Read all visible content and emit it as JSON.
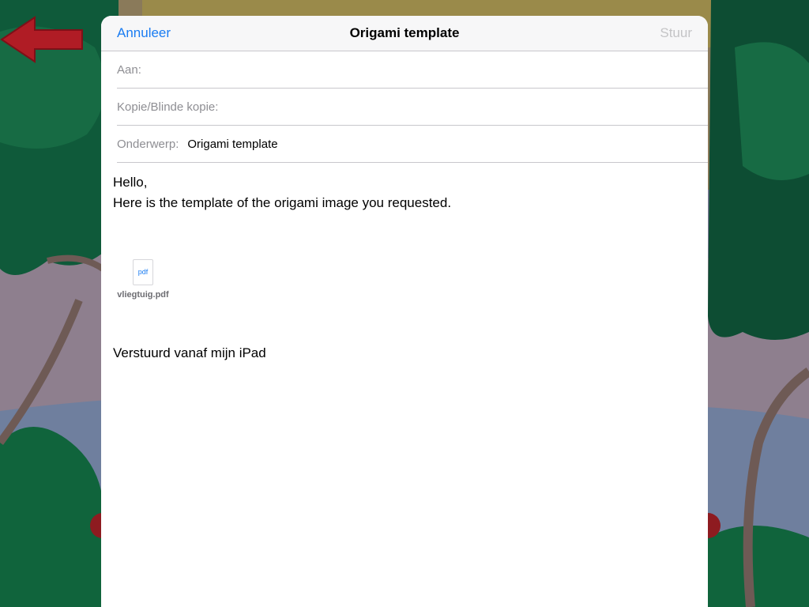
{
  "navbar": {
    "cancel_label": "Annuleer",
    "title": "Origami template",
    "send_label": "Stuur"
  },
  "fields": {
    "to_label": "Aan:",
    "cc_label": "Kopie/Blinde kopie:",
    "subject_label": "Onderwerp:",
    "subject_value": "Origami template"
  },
  "message": {
    "greeting": "Hello,",
    "text": "Here is the template of the origami image you requested.",
    "signature": "Verstuurd vanaf mijn iPad"
  },
  "attachment": {
    "icon_label": "pdf",
    "filename": "vliegtuig.pdf"
  },
  "colors": {
    "accent": "#1a7cf2",
    "disabled": "#c4c4c6",
    "back_arrow": "#b01c25"
  }
}
